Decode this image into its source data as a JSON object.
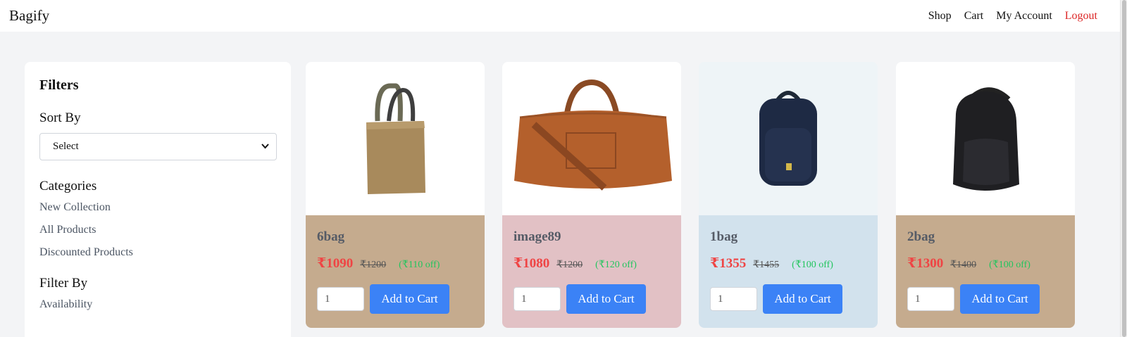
{
  "header": {
    "brand": "Bagify",
    "nav": [
      "Shop",
      "Cart",
      "My Account",
      "Logout"
    ]
  },
  "filters": {
    "title": "Filters",
    "sort_label": "Sort By",
    "sort_value": "Select",
    "categories_label": "Categories",
    "categories": [
      "New Collection",
      "All Products",
      "Discounted Products"
    ],
    "filter_by_label": "Filter By",
    "filter_by_items": [
      "Availability"
    ]
  },
  "products": [
    {
      "name": "6bag",
      "price": "₹1090",
      "old_price": "₹1200",
      "discount": "(₹110 off)",
      "qty": "1",
      "add_label": "Add to Cart",
      "bg": "#c5ab8e",
      "img_bg": "#ffffff",
      "image": "tote-bag-icon"
    },
    {
      "name": "image89",
      "price": "₹1080",
      "old_price": "₹1200",
      "discount": "(₹120 off)",
      "qty": "1",
      "add_label": "Add to Cart",
      "bg": "#e2c1c5",
      "img_bg": "#ffffff",
      "image": "duffel-bag-icon"
    },
    {
      "name": "1bag",
      "price": "₹1355",
      "old_price": "₹1455",
      "discount": "(₹100 off)",
      "qty": "1",
      "add_label": "Add to Cart",
      "bg": "#d2e2ed",
      "img_bg": "#eef4f7",
      "image": "navy-backpack-icon"
    },
    {
      "name": "2bag",
      "price": "₹1300",
      "old_price": "₹1400",
      "discount": "(₹100 off)",
      "qty": "1",
      "add_label": "Add to Cart",
      "bg": "#c5ab8e",
      "img_bg": "#ffffff",
      "image": "black-backpack-icon"
    }
  ],
  "colors": {
    "accent": "#3b82f6",
    "price": "#ef4444",
    "discount": "#22c55e",
    "logout": "#dc2626"
  }
}
